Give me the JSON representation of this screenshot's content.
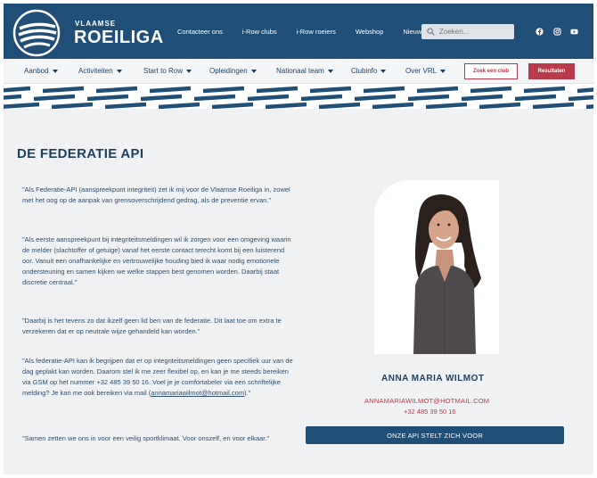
{
  "brand": {
    "small": "VLAAMSE",
    "big": "ROEILIGA"
  },
  "toplinks": [
    "Contacteer ons",
    "i-Row clubs",
    "i-Row roeiers",
    "Webshop",
    "Nieuws"
  ],
  "search": {
    "placeholder": "Zoeken..."
  },
  "nav": [
    {
      "label": "Aanbod"
    },
    {
      "label": "Activiteiten"
    },
    {
      "label": "Start to Row"
    },
    {
      "label": "Opleidingen"
    },
    {
      "label": "Nationaal team"
    },
    {
      "label": "Clubinfo"
    },
    {
      "label": "Over VRL"
    }
  ],
  "buttons": {
    "find_club": "Zoek een club",
    "results": "Resultaten"
  },
  "page": {
    "title": "DE FEDERATIE API"
  },
  "paragraphs": {
    "p1": "\"Als Federatie-API (aanspreekpunt integriteit) zet ik mij voor de Vlaamse Roeiliga in, zowel met het oog op de aanpak van grensoverschrijdend gedrag, als de preventie ervan.\"",
    "p2": "\"Als eerste aanspreekpunt bij integriteitsmeldingen wil ik zorgen voor een omgeving waarin de melder (slachtoffer of getuige) vanaf het eerste contact terecht komt bij een luisterend oor. Vanuit een onafhankelijke en vertrouwelijke houding bied ik waar nodig emotionele ondersteuning en samen kijken we welke stappen best genomen worden. Daarbij staat discretie centraal.\"",
    "p3": "\"Daarbij is het tevens zo dat ikzelf geen lid ben van de federatie. Dit laat toe om extra te verzekeren dat er op neutrale wijze gehandeld kan worden.\"",
    "p4_text": "\"Als federatie-API kan ik begrijpen dat er op integriteitsmeldingen geen specifiek uur van de dag geplakt kan worden. Daarom stel ik me zeer flexibel op, en kan je me steeds bereiken via GSM op het nummer +32 485 39 50 16. Voel je je comfortabeler via een schriftelijke melding? Je kan me ook bereiken via mail (",
    "p4_link": "annamariawilmot@hotmail.com",
    "p4_end": ").\"",
    "p5": "\"Samen zetten we ons in voor een veilig sportklimaat. Voor onszelf, en voor elkaar.\""
  },
  "contact": {
    "name": "ANNA MARIA WILMOT",
    "email": "ANNAMARIAWILMOT@HOTMAIL.COM",
    "phone": "+32 485 39 50 16",
    "cta": "ONZE API STELT ZICH VOOR"
  },
  "colors": {
    "navy": "#1f4f76",
    "accent": "#b83a4b",
    "background": "#f0f1f3"
  },
  "icons": [
    "logo-rowing-mark",
    "search-icon",
    "facebook-icon",
    "instagram-icon",
    "youtube-icon",
    "chevron-down-icon"
  ]
}
